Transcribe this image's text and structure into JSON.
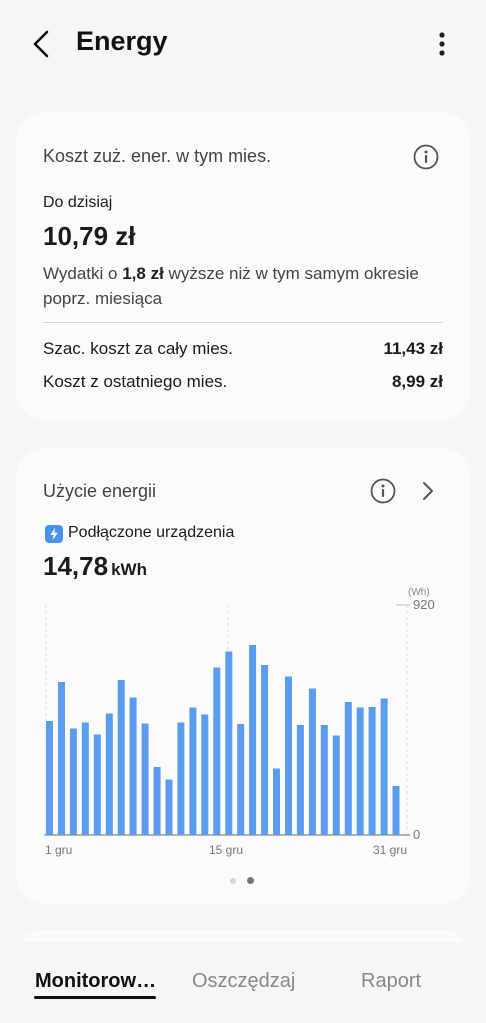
{
  "header": {
    "title": "Energy"
  },
  "cost_card": {
    "title": "Koszt zuż. ener. w tym mies.",
    "to_date_label": "Do dzisiaj",
    "to_date_value": "10,79 zł",
    "comparison_prefix": "Wydatki o ",
    "comparison_amount": "1,8 zł",
    "comparison_line1_suffix": " wyższe niż w tym samym okresie",
    "comparison_line2": "poprz. miesiąca",
    "rows": [
      {
        "label": "Szac. koszt za cały mies.",
        "value": "11,43 zł"
      },
      {
        "label": "Koszt z ostatniego mies.",
        "value": "8,99 zł"
      }
    ]
  },
  "usage_card": {
    "title": "Użycie energii",
    "device_label": "Podłączone urządzenia",
    "total_value": "14,78",
    "total_unit": "kWh",
    "page_dots": {
      "count": 2,
      "active": 1
    }
  },
  "chart_data": {
    "type": "bar",
    "unit_label": "(Wh)",
    "ylim": [
      0,
      920
    ],
    "y_ticks": [
      "920",
      "0"
    ],
    "x_tick_labels": [
      "1 gru",
      "15 gru",
      "31 gru"
    ],
    "categories": [
      1,
      2,
      3,
      4,
      5,
      6,
      7,
      8,
      9,
      10,
      11,
      12,
      13,
      14,
      15,
      16,
      17,
      18,
      19,
      20,
      21,
      22,
      23,
      24,
      25,
      26,
      27,
      28,
      29,
      30,
      31
    ],
    "values": [
      456,
      612,
      426,
      450,
      402,
      486,
      620,
      550,
      446,
      272,
      222,
      450,
      510,
      482,
      670,
      734,
      444,
      760,
      680,
      266,
      634,
      440,
      586,
      440,
      398,
      532,
      510,
      512,
      546,
      196,
      0
    ],
    "bar_color": "#5b9cf1"
  },
  "tabs": [
    {
      "label": "Monitorow…",
      "active": true
    },
    {
      "label": "Oszczędzaj",
      "active": false
    },
    {
      "label": "Raport",
      "active": false
    }
  ],
  "colors": {
    "accent": "#5b9cf1",
    "background": "#f6f6f6",
    "card": "#fbfbfb"
  }
}
